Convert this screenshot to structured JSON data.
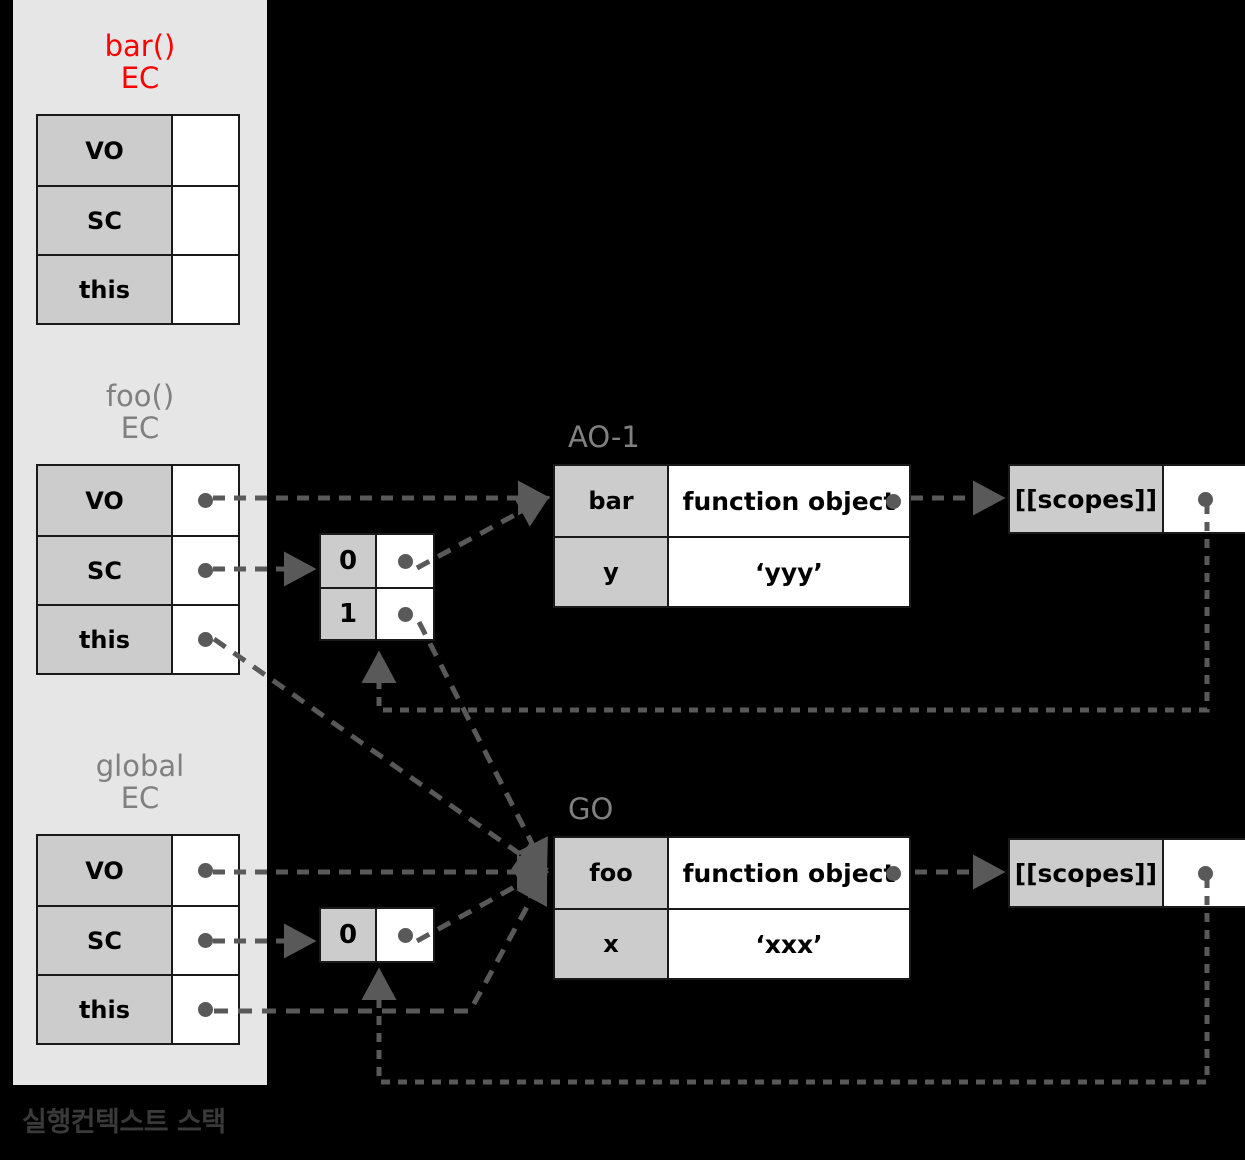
{
  "stack": {
    "caption": "실행컨텍스트 스택",
    "contexts": [
      {
        "title": "bar()\nEC",
        "active": true,
        "rows": [
          {
            "key": "VO",
            "value": ""
          },
          {
            "key": "SC",
            "value": ""
          },
          {
            "key": "this",
            "value": ""
          }
        ]
      },
      {
        "title": "foo()\nEC",
        "active": false,
        "rows": [
          {
            "key": "VO",
            "value": ""
          },
          {
            "key": "SC",
            "value": ""
          },
          {
            "key": "this",
            "value": ""
          }
        ]
      },
      {
        "title": "global\nEC",
        "active": false,
        "rows": [
          {
            "key": "VO",
            "value": ""
          },
          {
            "key": "SC",
            "value": ""
          },
          {
            "key": "this",
            "value": ""
          }
        ]
      }
    ]
  },
  "objects": {
    "ao1": {
      "title": "AO-1",
      "rows": [
        {
          "key": "bar",
          "value": "function object"
        },
        {
          "key": "y",
          "value": "‘yyy’"
        }
      ]
    },
    "go": {
      "title": "GO",
      "rows": [
        {
          "key": "foo",
          "value": "function object"
        },
        {
          "key": "x",
          "value": "‘xxx’"
        }
      ]
    }
  },
  "scope_arrays": {
    "foo_sc": {
      "rows": [
        {
          "key": "0"
        },
        {
          "key": "1"
        }
      ]
    },
    "global_sc": {
      "rows": [
        {
          "key": "0"
        }
      ]
    }
  },
  "scopes_boxes": {
    "bar_scopes": {
      "label": "[[scopes]]"
    },
    "foo_scopes": {
      "label": "[[scopes]]"
    }
  },
  "colors": {
    "background": "#000000",
    "panel": "#e6e6e6",
    "key_cell": "#cccccc",
    "value_cell": "#ffffff",
    "border": "#1a1a1a",
    "wire": "#595959",
    "active_title": "#ff0000",
    "inactive_title": "#808080",
    "caption": "#3a3a3a"
  }
}
